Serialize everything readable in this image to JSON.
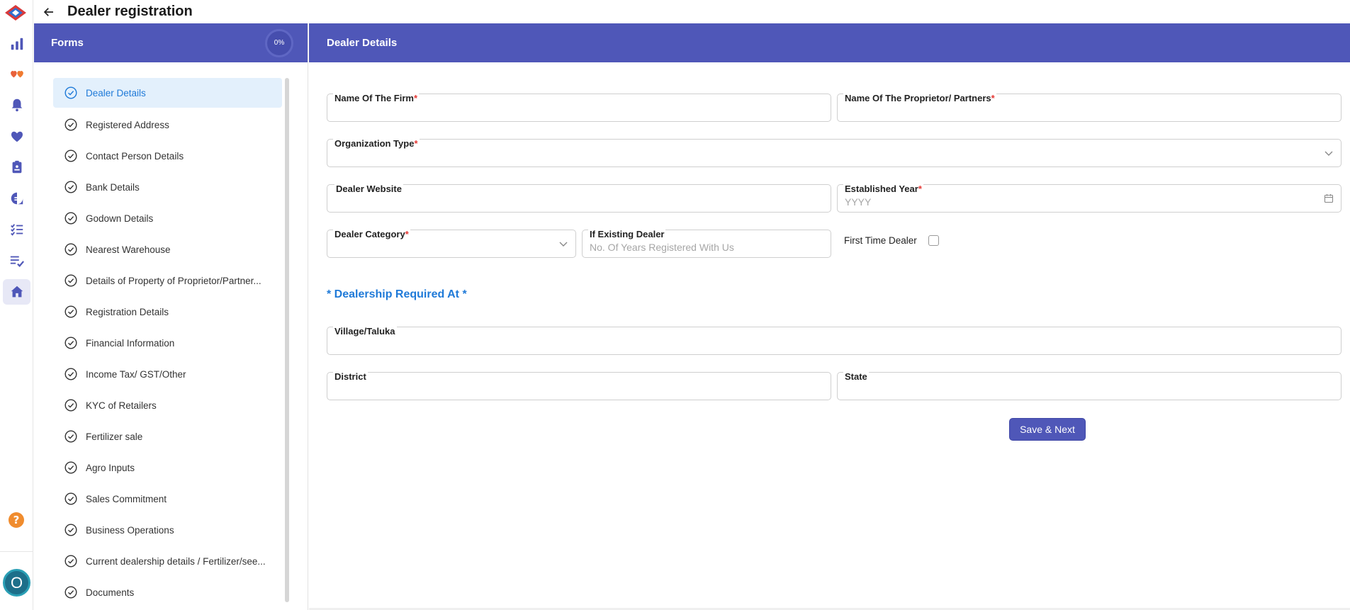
{
  "app": {
    "title": "Dealer registration"
  },
  "colors": {
    "primary": "#4f57b8",
    "accent_blue": "#1f7ad8",
    "required": "#e53935"
  },
  "rail": {
    "items": [
      "bar-chart-icon",
      "hearts-icon",
      "bell-icon",
      "heart-icon",
      "clipboard-icon",
      "chat-icon",
      "checklist-icon",
      "playlist-check-icon",
      "home-icon"
    ],
    "active": "home-icon"
  },
  "avatar": {
    "initial": "O"
  },
  "forms": {
    "label": "Forms",
    "progress": "0%",
    "items": [
      "Dealer Details",
      "Registered Address",
      "Contact Person Details",
      "Bank Details",
      "Godown Details",
      "Nearest Warehouse",
      "Details of Property of Proprietor/Partner...",
      "Registration Details",
      "Financial Information",
      "Income Tax/ GST/Other",
      "KYC of Retailers",
      "Fertilizer sale",
      "Agro Inputs",
      "Sales Commitment",
      "Business Operations",
      "Current dealership details / Fertilizer/see...",
      "Documents"
    ],
    "active_index": 0
  },
  "main": {
    "header": "Dealer Details",
    "fields": {
      "firm_name": {
        "label": "Name Of The Firm",
        "required": "*",
        "value": ""
      },
      "proprietor": {
        "label": "Name Of The Proprietor/ Partners",
        "required": "*",
        "value": ""
      },
      "org_type": {
        "label": "Organization Type",
        "required": "*",
        "value": ""
      },
      "website": {
        "label": "Dealer Website",
        "value": ""
      },
      "established_year": {
        "label": "Established Year",
        "required": "*",
        "placeholder": "YYYY"
      },
      "dealer_category": {
        "label": "Dealer Category",
        "required": "*",
        "value": ""
      },
      "existing_dealer": {
        "label": "If Existing Dealer",
        "placeholder": "No. Of Years Registered With Us"
      },
      "village": {
        "label": "Village/Taluka",
        "value": ""
      },
      "district": {
        "label": "District",
        "value": ""
      },
      "state": {
        "label": "State",
        "value": ""
      }
    },
    "first_time_dealer": {
      "label": "First Time Dealer",
      "checked": false
    },
    "section_title": "* Dealership Required At *",
    "save_button": "Save & Next"
  }
}
